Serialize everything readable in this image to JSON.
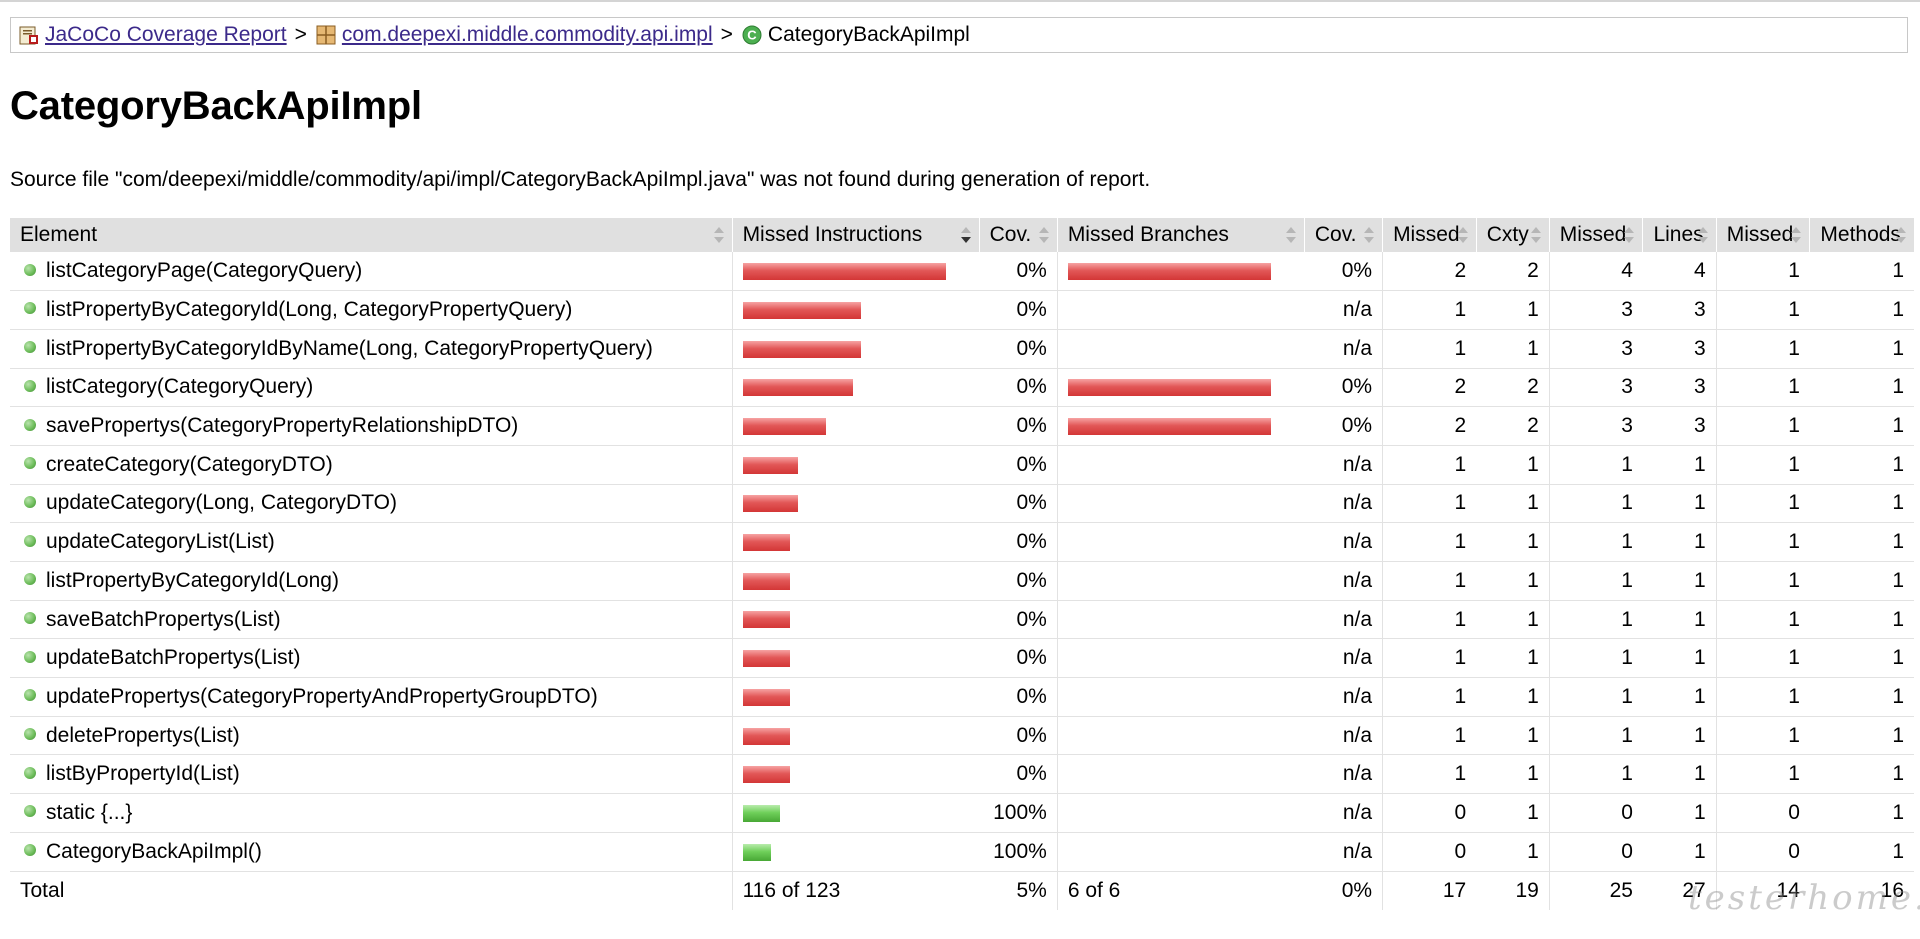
{
  "breadcrumb": {
    "root": "JaCoCo Coverage Report",
    "package": "com.deepexi.middle.commodity.api.impl",
    "current": "CategoryBackApiImpl",
    "separator": ">"
  },
  "title": "CategoryBackApiImpl",
  "description": "Source file \"com/deepexi/middle/commodity/api/impl/CategoryBackApiImpl.java\" was not found during generation of report.",
  "columns": [
    "Element",
    "Missed Instructions",
    "Cov.",
    "Missed Branches",
    "Cov.",
    "Missed",
    "Cxty",
    "Missed",
    "Lines",
    "Missed",
    "Methods"
  ],
  "rows": [
    {
      "element": "listCategoryPage(CategoryQuery)",
      "instr_red": 1.0,
      "instr_green": 0,
      "instr_cov": "0%",
      "branch_red": 1.0,
      "branch_cov": "0%",
      "missed_cxty": "2",
      "cxty": "2",
      "missed_lines": "4",
      "lines": "4",
      "missed_methods": "1",
      "methods": "1"
    },
    {
      "element": "listPropertyByCategoryId(Long, CategoryPropertyQuery)",
      "instr_red": 0.58,
      "instr_green": 0,
      "instr_cov": "0%",
      "branch_red": 0,
      "branch_cov": "n/a",
      "missed_cxty": "1",
      "cxty": "1",
      "missed_lines": "3",
      "lines": "3",
      "missed_methods": "1",
      "methods": "1"
    },
    {
      "element": "listPropertyByCategoryIdByName(Long, CategoryPropertyQuery)",
      "instr_red": 0.58,
      "instr_green": 0,
      "instr_cov": "0%",
      "branch_red": 0,
      "branch_cov": "n/a",
      "missed_cxty": "1",
      "cxty": "1",
      "missed_lines": "3",
      "lines": "3",
      "missed_methods": "1",
      "methods": "1"
    },
    {
      "element": "listCategory(CategoryQuery)",
      "instr_red": 0.54,
      "instr_green": 0,
      "instr_cov": "0%",
      "branch_red": 1.0,
      "branch_cov": "0%",
      "missed_cxty": "2",
      "cxty": "2",
      "missed_lines": "3",
      "lines": "3",
      "missed_methods": "1",
      "methods": "1"
    },
    {
      "element": "savePropertys(CategoryPropertyRelationshipDTO)",
      "instr_red": 0.41,
      "instr_green": 0,
      "instr_cov": "0%",
      "branch_red": 1.0,
      "branch_cov": "0%",
      "missed_cxty": "2",
      "cxty": "2",
      "missed_lines": "3",
      "lines": "3",
      "missed_methods": "1",
      "methods": "1"
    },
    {
      "element": "createCategory(CategoryDTO)",
      "instr_red": 0.27,
      "instr_green": 0,
      "instr_cov": "0%",
      "branch_red": 0,
      "branch_cov": "n/a",
      "missed_cxty": "1",
      "cxty": "1",
      "missed_lines": "1",
      "lines": "1",
      "missed_methods": "1",
      "methods": "1"
    },
    {
      "element": "updateCategory(Long, CategoryDTO)",
      "instr_red": 0.27,
      "instr_green": 0,
      "instr_cov": "0%",
      "branch_red": 0,
      "branch_cov": "n/a",
      "missed_cxty": "1",
      "cxty": "1",
      "missed_lines": "1",
      "lines": "1",
      "missed_methods": "1",
      "methods": "1"
    },
    {
      "element": "updateCategoryList(List)",
      "instr_red": 0.23,
      "instr_green": 0,
      "instr_cov": "0%",
      "branch_red": 0,
      "branch_cov": "n/a",
      "missed_cxty": "1",
      "cxty": "1",
      "missed_lines": "1",
      "lines": "1",
      "missed_methods": "1",
      "methods": "1"
    },
    {
      "element": "listPropertyByCategoryId(Long)",
      "instr_red": 0.23,
      "instr_green": 0,
      "instr_cov": "0%",
      "branch_red": 0,
      "branch_cov": "n/a",
      "missed_cxty": "1",
      "cxty": "1",
      "missed_lines": "1",
      "lines": "1",
      "missed_methods": "1",
      "methods": "1"
    },
    {
      "element": "saveBatchPropertys(List)",
      "instr_red": 0.23,
      "instr_green": 0,
      "instr_cov": "0%",
      "branch_red": 0,
      "branch_cov": "n/a",
      "missed_cxty": "1",
      "cxty": "1",
      "missed_lines": "1",
      "lines": "1",
      "missed_methods": "1",
      "methods": "1"
    },
    {
      "element": "updateBatchPropertys(List)",
      "instr_red": 0.23,
      "instr_green": 0,
      "instr_cov": "0%",
      "branch_red": 0,
      "branch_cov": "n/a",
      "missed_cxty": "1",
      "cxty": "1",
      "missed_lines": "1",
      "lines": "1",
      "missed_methods": "1",
      "methods": "1"
    },
    {
      "element": "updatePropertys(CategoryPropertyAndPropertyGroupDTO)",
      "instr_red": 0.23,
      "instr_green": 0,
      "instr_cov": "0%",
      "branch_red": 0,
      "branch_cov": "n/a",
      "missed_cxty": "1",
      "cxty": "1",
      "missed_lines": "1",
      "lines": "1",
      "missed_methods": "1",
      "methods": "1"
    },
    {
      "element": "deletePropertys(List)",
      "instr_red": 0.23,
      "instr_green": 0,
      "instr_cov": "0%",
      "branch_red": 0,
      "branch_cov": "n/a",
      "missed_cxty": "1",
      "cxty": "1",
      "missed_lines": "1",
      "lines": "1",
      "missed_methods": "1",
      "methods": "1"
    },
    {
      "element": "listByPropertyId(List)",
      "instr_red": 0.23,
      "instr_green": 0,
      "instr_cov": "0%",
      "branch_red": 0,
      "branch_cov": "n/a",
      "missed_cxty": "1",
      "cxty": "1",
      "missed_lines": "1",
      "lines": "1",
      "missed_methods": "1",
      "methods": "1"
    },
    {
      "element": "static {...}",
      "instr_red": 0,
      "instr_green": 0.18,
      "instr_cov": "100%",
      "branch_red": 0,
      "branch_cov": "n/a",
      "missed_cxty": "0",
      "cxty": "1",
      "missed_lines": "0",
      "lines": "1",
      "missed_methods": "0",
      "methods": "1"
    },
    {
      "element": "CategoryBackApiImpl()",
      "instr_red": 0,
      "instr_green": 0.14,
      "instr_cov": "100%",
      "branch_red": 0,
      "branch_cov": "n/a",
      "missed_cxty": "0",
      "cxty": "1",
      "missed_lines": "0",
      "lines": "1",
      "missed_methods": "0",
      "methods": "1"
    }
  ],
  "total": {
    "label": "Total",
    "instructions": "116 of 123",
    "instr_cov": "5%",
    "branches": "6 of 6",
    "branch_cov": "0%",
    "missed_cxty": "17",
    "cxty": "19",
    "missed_lines": "25",
    "lines": "27",
    "missed_methods": "14",
    "methods": "16"
  },
  "watermark": "testerhome.com",
  "colors": {
    "link": "#3c2a8a",
    "missed_bar": "#d33636",
    "covered_bar": "#48a835",
    "header_bg": "#e0e0e0"
  }
}
